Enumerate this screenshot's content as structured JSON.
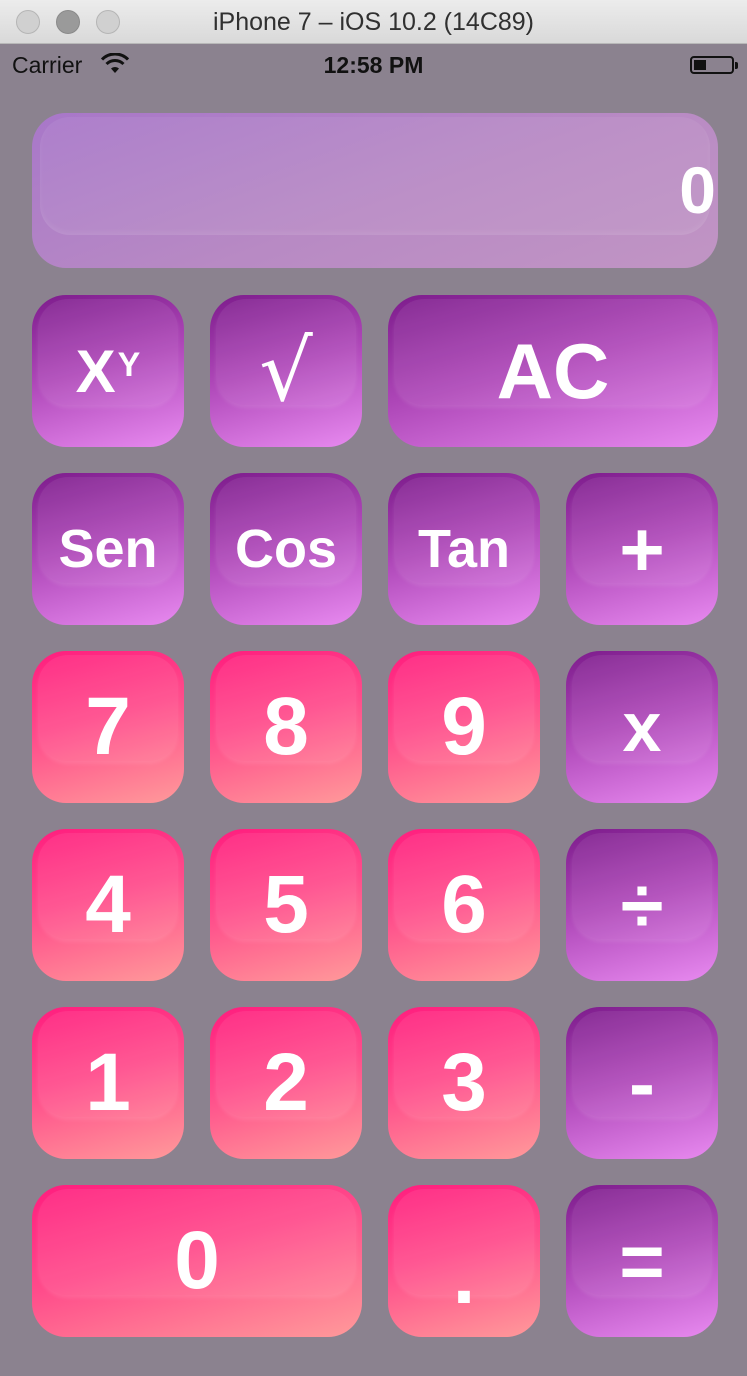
{
  "window": {
    "title": "iPhone 7 – iOS 10.2 (14C89)"
  },
  "status_bar": {
    "carrier": "Carrier",
    "time": "12:58 PM"
  },
  "display": {
    "value": "0"
  },
  "keys": {
    "power_base": "X",
    "power_exp": "Y",
    "sqrt": "√",
    "clear": "AC",
    "sin": "Sen",
    "cos": "Cos",
    "tan": "Tan",
    "add": "+",
    "seven": "7",
    "eight": "8",
    "nine": "9",
    "multiply": "x",
    "four": "4",
    "five": "5",
    "six": "6",
    "divide": "÷",
    "one": "1",
    "two": "2",
    "three": "3",
    "subtract": "-",
    "zero": "0",
    "decimal": ".",
    "equals": "="
  },
  "colors": {
    "background": "#8b828f",
    "function_key": "#ad46b7",
    "number_key": "#ff4c8b"
  }
}
